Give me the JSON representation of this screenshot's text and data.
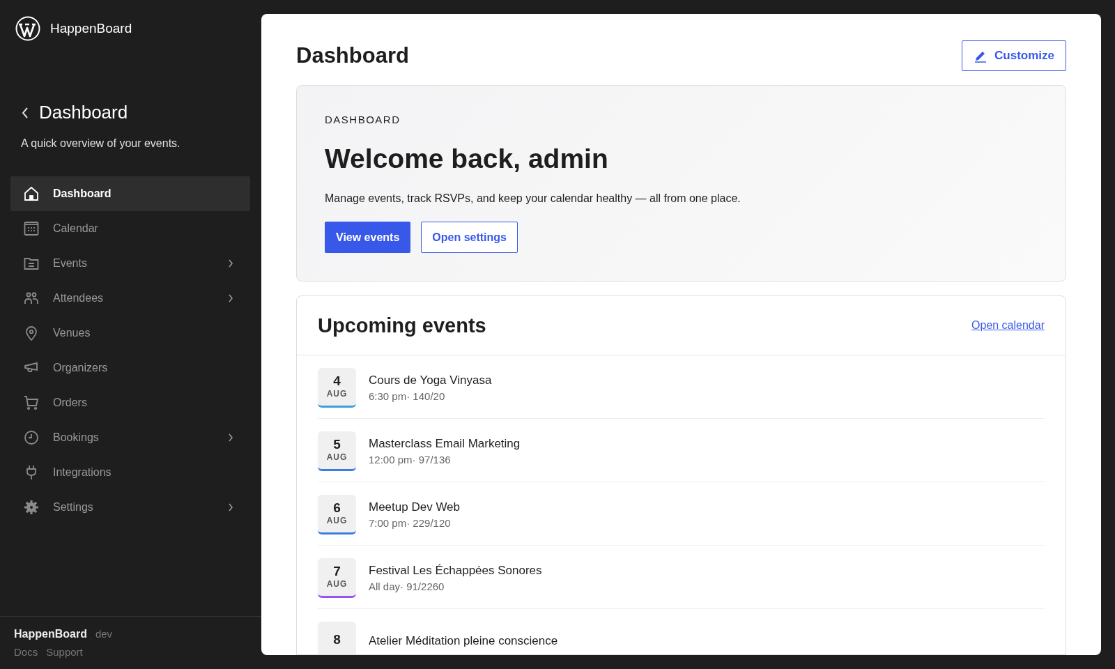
{
  "brand": {
    "name": "HappenBoard"
  },
  "sidebar": {
    "back_title": "Dashboard",
    "subtitle": "A quick overview of your events.",
    "items": [
      {
        "label": "Dashboard",
        "kind": "home",
        "selected": true,
        "expandable": false
      },
      {
        "label": "Calendar",
        "kind": "calendar",
        "selected": false,
        "expandable": false
      },
      {
        "label": "Events",
        "kind": "folder",
        "selected": false,
        "expandable": true
      },
      {
        "label": "Attendees",
        "kind": "people",
        "selected": false,
        "expandable": true
      },
      {
        "label": "Venues",
        "kind": "pin",
        "selected": false,
        "expandable": false
      },
      {
        "label": "Organizers",
        "kind": "megaphone",
        "selected": false,
        "expandable": false
      },
      {
        "label": "Orders",
        "kind": "cart",
        "selected": false,
        "expandable": false
      },
      {
        "label": "Bookings",
        "kind": "clock",
        "selected": false,
        "expandable": true
      },
      {
        "label": "Integrations",
        "kind": "plug",
        "selected": false,
        "expandable": false
      },
      {
        "label": "Settings",
        "kind": "gear",
        "selected": false,
        "expandable": true
      }
    ],
    "footer": {
      "name": "HappenBoard",
      "env": "dev",
      "links": [
        "Docs",
        "Support"
      ]
    }
  },
  "page": {
    "title": "Dashboard",
    "customize_button": "Customize"
  },
  "hero": {
    "eyebrow": "DASHBOARD",
    "heading": "Welcome back, admin",
    "text": "Manage events, track RSVPs, and keep your calendar healthy — all from one place.",
    "primary_button": "View events",
    "secondary_button": "Open settings"
  },
  "upcoming": {
    "title": "Upcoming events",
    "link": "Open calendar",
    "events": [
      {
        "day": "4",
        "month": "AUG",
        "title": "Cours de Yoga Vinyasa",
        "meta": "6:30 pm· 140/20",
        "color": "#3aa0d8"
      },
      {
        "day": "5",
        "month": "AUG",
        "title": "Masterclass Email Marketing",
        "meta": "12:00 pm· 97/136",
        "color": "#3a7fe0"
      },
      {
        "day": "6",
        "month": "AUG",
        "title": "Meetup Dev Web",
        "meta": "7:00 pm· 229/120",
        "color": "#3a7fe0"
      },
      {
        "day": "7",
        "month": "AUG",
        "title": "Festival Les Échappées Sonores",
        "meta": "All day· 91/2260",
        "color": "#9a55ee"
      },
      {
        "day": "8",
        "title": "Atelier Méditation pleine conscience"
      }
    ]
  }
}
